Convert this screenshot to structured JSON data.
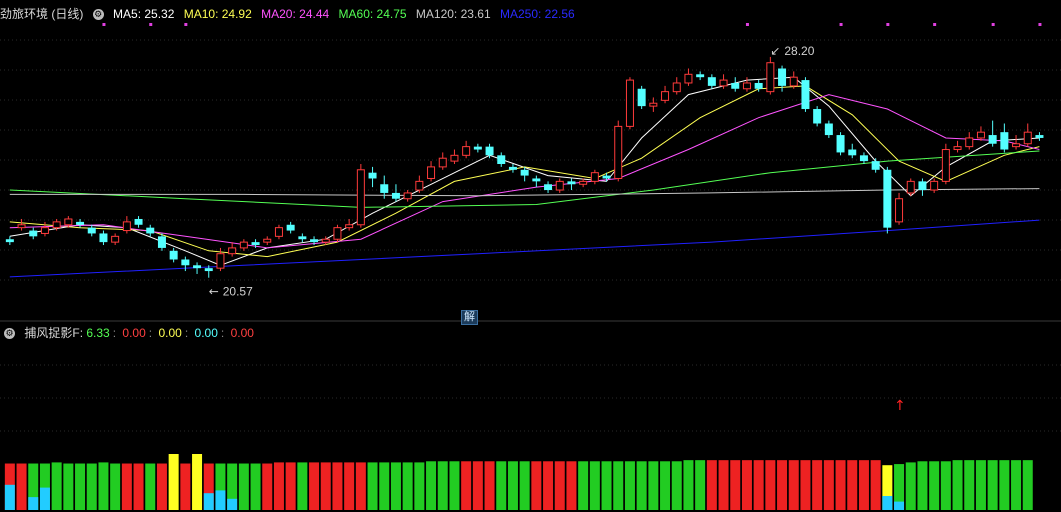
{
  "main_header": {
    "stock_name": "劲旅环境 (日线)",
    "ma5": "MA5: 25.32",
    "ma10": "MA10: 24.92",
    "ma20": "MA20: 24.44",
    "ma60": "MA60: 24.75",
    "ma120": "MA120: 23.61",
    "ma250": "MA250: 22.56"
  },
  "sub_header": {
    "name": "捕风捉影F",
    "v1": "6.33",
    "v2": "0.00",
    "v3": "0.00",
    "v4": "0.00",
    "v5": "0.00"
  },
  "badge_label": "解",
  "colors": {
    "up": "#ff3b3b",
    "down": "#54ffff",
    "ma5": "#ffffff",
    "ma10": "#ffff54",
    "ma20": "#ff54ff",
    "ma60": "#54ff54",
    "ma120": "#c8c8c8",
    "ma250": "#2020ff",
    "green_bar": "#22cc22",
    "red_bar": "#ee2222",
    "yellow_bar": "#ffff22",
    "cyan_bar": "#22ccff"
  },
  "chart_data": {
    "type": "candlestick",
    "price_range": [
      19.8,
      29.2
    ],
    "high_marker": "28.20",
    "low_marker": "20.57",
    "candles": [
      [
        21.9,
        21.8,
        22.0,
        21.7
      ],
      [
        22.3,
        22.4,
        22.6,
        22.2
      ],
      [
        22.2,
        22.0,
        22.3,
        21.9
      ],
      [
        22.1,
        22.3,
        22.5,
        22.0
      ],
      [
        22.3,
        22.5,
        22.6,
        22.2
      ],
      [
        22.4,
        22.6,
        22.7,
        22.3
      ],
      [
        22.5,
        22.4,
        22.6,
        22.3
      ],
      [
        22.3,
        22.1,
        22.4,
        22.0
      ],
      [
        22.1,
        21.8,
        22.2,
        21.7
      ],
      [
        21.8,
        22.0,
        22.1,
        21.7
      ],
      [
        22.2,
        22.5,
        22.7,
        22.1
      ],
      [
        22.6,
        22.4,
        22.7,
        22.3
      ],
      [
        22.3,
        22.1,
        22.4,
        22.0
      ],
      [
        22.0,
        21.6,
        22.1,
        21.5
      ],
      [
        21.5,
        21.2,
        21.6,
        21.1
      ],
      [
        21.2,
        21.0,
        21.3,
        20.8
      ],
      [
        21.0,
        20.9,
        21.1,
        20.7
      ],
      [
        20.9,
        20.8,
        21.0,
        20.57
      ],
      [
        20.9,
        21.4,
        21.6,
        20.8
      ],
      [
        21.4,
        21.6,
        21.8,
        21.3
      ],
      [
        21.6,
        21.8,
        21.9,
        21.5
      ],
      [
        21.8,
        21.7,
        21.9,
        21.6
      ],
      [
        21.8,
        21.9,
        22.0,
        21.7
      ],
      [
        22.0,
        22.3,
        22.4,
        21.9
      ],
      [
        22.4,
        22.2,
        22.5,
        22.1
      ],
      [
        22.0,
        21.9,
        22.1,
        21.8
      ],
      [
        21.9,
        21.8,
        22.0,
        21.7
      ],
      [
        21.8,
        21.9,
        22.0,
        21.7
      ],
      [
        21.9,
        22.3,
        22.4,
        21.8
      ],
      [
        22.3,
        22.4,
        22.6,
        22.2
      ],
      [
        22.4,
        24.3,
        24.5,
        22.3
      ],
      [
        24.2,
        24.0,
        24.4,
        23.7
      ],
      [
        23.8,
        23.5,
        24.1,
        23.3
      ],
      [
        23.5,
        23.3,
        23.8,
        23.2
      ],
      [
        23.3,
        23.5,
        23.6,
        23.2
      ],
      [
        23.6,
        23.9,
        24.1,
        23.5
      ],
      [
        24.0,
        24.4,
        24.6,
        23.9
      ],
      [
        24.4,
        24.7,
        24.9,
        24.3
      ],
      [
        24.6,
        24.8,
        25.0,
        24.5
      ],
      [
        24.8,
        25.1,
        25.3,
        24.7
      ],
      [
        25.1,
        25.0,
        25.2,
        24.9
      ],
      [
        25.1,
        24.8,
        25.2,
        24.7
      ],
      [
        24.8,
        24.5,
        24.9,
        24.4
      ],
      [
        24.4,
        24.3,
        24.5,
        24.2
      ],
      [
        24.3,
        24.1,
        24.4,
        23.9
      ],
      [
        24.0,
        23.9,
        24.1,
        23.7
      ],
      [
        23.8,
        23.6,
        23.9,
        23.5
      ],
      [
        23.6,
        23.9,
        24.0,
        23.5
      ],
      [
        23.9,
        23.8,
        24.0,
        23.6
      ],
      [
        23.8,
        23.9,
        24.0,
        23.7
      ],
      [
        23.9,
        24.2,
        24.3,
        23.8
      ],
      [
        24.1,
        24.0,
        24.2,
        23.9
      ],
      [
        24.0,
        25.8,
        26.0,
        23.9
      ],
      [
        25.8,
        27.4,
        27.5,
        25.7
      ],
      [
        27.1,
        26.5,
        27.2,
        26.4
      ],
      [
        26.5,
        26.6,
        26.8,
        26.3
      ],
      [
        26.7,
        27.0,
        27.2,
        26.6
      ],
      [
        27.0,
        27.3,
        27.5,
        26.9
      ],
      [
        27.3,
        27.6,
        27.8,
        27.2
      ],
      [
        27.6,
        27.5,
        27.7,
        27.4
      ],
      [
        27.5,
        27.2,
        27.6,
        27.1
      ],
      [
        27.2,
        27.4,
        27.6,
        27.1
      ],
      [
        27.3,
        27.1,
        27.5,
        27.0
      ],
      [
        27.1,
        27.3,
        27.5,
        27.0
      ],
      [
        27.3,
        27.1,
        27.4,
        27.0
      ],
      [
        27.0,
        28.0,
        28.2,
        26.9
      ],
      [
        27.8,
        27.2,
        27.9,
        27.0
      ],
      [
        27.2,
        27.5,
        27.7,
        27.1
      ],
      [
        27.4,
        26.4,
        27.5,
        26.3
      ],
      [
        26.4,
        25.9,
        26.5,
        25.8
      ],
      [
        25.9,
        25.5,
        26.0,
        25.4
      ],
      [
        25.5,
        24.9,
        25.6,
        24.8
      ],
      [
        25.0,
        24.8,
        25.2,
        24.7
      ],
      [
        24.8,
        24.6,
        24.9,
        24.5
      ],
      [
        24.6,
        24.3,
        24.7,
        24.2
      ],
      [
        24.3,
        22.3,
        24.4,
        22.1
      ],
      [
        22.5,
        23.3,
        23.5,
        22.4
      ],
      [
        23.5,
        23.9,
        24.0,
        23.4
      ],
      [
        23.9,
        23.6,
        24.0,
        23.4
      ],
      [
        23.6,
        23.9,
        24.0,
        23.5
      ],
      [
        23.9,
        25.0,
        25.2,
        23.8
      ],
      [
        25.0,
        25.1,
        25.3,
        24.9
      ],
      [
        25.1,
        25.4,
        25.6,
        25.0
      ],
      [
        25.4,
        25.6,
        25.8,
        25.3
      ],
      [
        25.5,
        25.2,
        26.0,
        25.1
      ],
      [
        25.6,
        25.0,
        25.9,
        24.9
      ],
      [
        25.1,
        25.2,
        25.5,
        25.0
      ],
      [
        25.2,
        25.6,
        25.9,
        25.1
      ],
      [
        25.5,
        25.4,
        25.6,
        25.3
      ]
    ],
    "ma": {
      "ma5": [
        [
          0,
          22.0
        ],
        [
          6,
          22.4
        ],
        [
          10,
          22.3
        ],
        [
          15,
          21.5
        ],
        [
          18,
          21.0
        ],
        [
          22,
          21.6
        ],
        [
          27,
          21.9
        ],
        [
          31,
          22.8
        ],
        [
          36,
          23.8
        ],
        [
          41,
          24.8
        ],
        [
          46,
          24.1
        ],
        [
          51,
          23.9
        ],
        [
          54,
          25.4
        ],
        [
          58,
          26.9
        ],
        [
          63,
          27.4
        ],
        [
          67,
          27.5
        ],
        [
          70,
          26.5
        ],
        [
          74,
          24.6
        ],
        [
          77,
          23.4
        ],
        [
          80,
          24.4
        ],
        [
          84,
          25.3
        ],
        [
          88,
          25.4
        ]
      ],
      "ma10": [
        [
          0,
          22.5
        ],
        [
          6,
          22.3
        ],
        [
          12,
          22.2
        ],
        [
          17,
          21.5
        ],
        [
          22,
          21.3
        ],
        [
          28,
          21.8
        ],
        [
          33,
          22.8
        ],
        [
          38,
          23.9
        ],
        [
          44,
          24.4
        ],
        [
          50,
          24.0
        ],
        [
          54,
          24.7
        ],
        [
          59,
          26.1
        ],
        [
          64,
          27.1
        ],
        [
          68,
          27.2
        ],
        [
          72,
          26.2
        ],
        [
          76,
          24.6
        ],
        [
          80,
          23.9
        ],
        [
          85,
          24.8
        ],
        [
          88,
          25.1
        ]
      ],
      "ma20": [
        [
          0,
          22.3
        ],
        [
          8,
          22.4
        ],
        [
          15,
          22.0
        ],
        [
          22,
          21.6
        ],
        [
          30,
          21.9
        ],
        [
          37,
          23.2
        ],
        [
          45,
          23.7
        ],
        [
          52,
          24.0
        ],
        [
          58,
          25.0
        ],
        [
          64,
          26.1
        ],
        [
          70,
          26.9
        ],
        [
          75,
          26.4
        ],
        [
          80,
          25.4
        ],
        [
          85,
          25.3
        ],
        [
          88,
          25.0
        ]
      ],
      "ma60": [
        [
          0,
          23.6
        ],
        [
          15,
          23.3
        ],
        [
          30,
          23.0
        ],
        [
          45,
          23.1
        ],
        [
          55,
          23.6
        ],
        [
          65,
          24.2
        ],
        [
          75,
          24.6
        ],
        [
          88,
          24.95
        ]
      ],
      "ma120": [
        [
          0,
          23.45
        ],
        [
          20,
          23.45
        ],
        [
          40,
          23.4
        ],
        [
          60,
          23.5
        ],
        [
          75,
          23.6
        ],
        [
          88,
          23.65
        ]
      ],
      "ma250": [
        [
          0,
          20.6
        ],
        [
          20,
          21.0
        ],
        [
          40,
          21.4
        ],
        [
          60,
          21.8
        ],
        [
          75,
          22.2
        ],
        [
          88,
          22.56
        ]
      ]
    },
    "top_marks": [
      8,
      12,
      15,
      63,
      71,
      75,
      79,
      84,
      88
    ],
    "indicator_bars": [
      [
        "red",
        "cyan"
      ],
      [
        "red",
        "none"
      ],
      [
        "green",
        "cyan"
      ],
      [
        "green",
        "cyan"
      ],
      [
        "green",
        "none"
      ],
      [
        "green",
        "none"
      ],
      [
        "green",
        "none"
      ],
      [
        "green",
        "none"
      ],
      [
        "green",
        "none"
      ],
      [
        "green",
        "none"
      ],
      [
        "red",
        "none"
      ],
      [
        "red",
        "none"
      ],
      [
        "green",
        "none"
      ],
      [
        "red",
        "none"
      ],
      [
        "yellow",
        "none"
      ],
      [
        "red",
        "none"
      ],
      [
        "yellow",
        "none"
      ],
      [
        "red",
        "cyan"
      ],
      [
        "green",
        "cyan"
      ],
      [
        "green",
        "cyan"
      ],
      [
        "green",
        "none"
      ],
      [
        "green",
        "none"
      ],
      [
        "red",
        "none"
      ],
      [
        "red",
        "none"
      ],
      [
        "red",
        "none"
      ],
      [
        "green",
        "none"
      ],
      [
        "red",
        "none"
      ],
      [
        "red",
        "none"
      ],
      [
        "red",
        "none"
      ],
      [
        "red",
        "none"
      ],
      [
        "red",
        "none"
      ],
      [
        "green",
        "none"
      ],
      [
        "green",
        "none"
      ],
      [
        "green",
        "none"
      ],
      [
        "green",
        "none"
      ],
      [
        "green",
        "none"
      ],
      [
        "green",
        "none"
      ],
      [
        "green",
        "none"
      ],
      [
        "green",
        "none"
      ],
      [
        "red",
        "none"
      ],
      [
        "red",
        "none"
      ],
      [
        "red",
        "none"
      ],
      [
        "green",
        "none"
      ],
      [
        "green",
        "none"
      ],
      [
        "green",
        "none"
      ],
      [
        "red",
        "none"
      ],
      [
        "red",
        "none"
      ],
      [
        "red",
        "none"
      ],
      [
        "red",
        "none"
      ],
      [
        "green",
        "none"
      ],
      [
        "green",
        "none"
      ],
      [
        "green",
        "none"
      ],
      [
        "green",
        "none"
      ],
      [
        "green",
        "none"
      ],
      [
        "green",
        "none"
      ],
      [
        "green",
        "none"
      ],
      [
        "green",
        "none"
      ],
      [
        "green",
        "none"
      ],
      [
        "green",
        "none"
      ],
      [
        "green",
        "none"
      ],
      [
        "red",
        "none"
      ],
      [
        "red",
        "none"
      ],
      [
        "red",
        "none"
      ],
      [
        "red",
        "none"
      ],
      [
        "red",
        "none"
      ],
      [
        "red",
        "none"
      ],
      [
        "red",
        "none"
      ],
      [
        "red",
        "none"
      ],
      [
        "red",
        "none"
      ],
      [
        "red",
        "none"
      ],
      [
        "red",
        "none"
      ],
      [
        "red",
        "none"
      ],
      [
        "red",
        "none"
      ],
      [
        "red",
        "none"
      ],
      [
        "red",
        "none"
      ],
      [
        "yellow",
        "cyan"
      ],
      [
        "green",
        "cyan"
      ],
      [
        "green",
        "none"
      ],
      [
        "green",
        "none"
      ],
      [
        "green",
        "none"
      ],
      [
        "green",
        "none"
      ],
      [
        "green",
        "none"
      ],
      [
        "green",
        "none"
      ],
      [
        "green",
        "none"
      ],
      [
        "green",
        "none"
      ],
      [
        "green",
        "none"
      ],
      [
        "green",
        "none"
      ],
      [
        "green",
        "none"
      ]
    ],
    "indicator_heights": [
      46,
      46,
      46,
      46,
      46,
      46,
      46,
      46,
      46,
      46,
      46,
      46,
      46,
      46,
      46,
      46,
      46,
      46,
      46,
      46,
      46,
      46,
      46,
      46,
      46,
      46,
      46,
      46,
      46,
      46,
      46,
      46,
      46,
      46,
      46,
      46,
      46,
      46,
      46,
      46,
      46,
      46,
      46,
      46,
      46,
      46,
      46,
      46,
      46,
      46,
      46,
      46,
      46,
      46,
      46,
      46,
      46,
      46,
      46,
      46,
      46,
      46,
      46,
      46,
      46,
      46,
      46,
      46,
      46,
      46,
      46,
      46,
      46,
      46,
      46,
      46,
      46,
      46,
      46,
      46,
      46,
      46,
      46,
      46,
      46,
      46,
      46,
      46
    ],
    "indicator_scale_max": 1.0,
    "indicator_values": [
      0.83,
      0.83,
      0.83,
      0.83,
      0.85,
      0.83,
      0.83,
      0.83,
      0.85,
      0.83,
      0.83,
      0.83,
      0.83,
      0.83,
      1.0,
      0.83,
      1.0,
      0.83,
      0.83,
      0.83,
      0.83,
      0.83,
      0.83,
      0.85,
      0.85,
      0.85,
      0.85,
      0.85,
      0.85,
      0.85,
      0.85,
      0.85,
      0.85,
      0.85,
      0.85,
      0.85,
      0.87,
      0.87,
      0.87,
      0.87,
      0.87,
      0.87,
      0.87,
      0.87,
      0.87,
      0.87,
      0.87,
      0.87,
      0.87,
      0.87,
      0.87,
      0.87,
      0.87,
      0.87,
      0.87,
      0.87,
      0.87,
      0.87,
      0.89,
      0.89,
      0.89,
      0.89,
      0.89,
      0.89,
      0.89,
      0.89,
      0.89,
      0.89,
      0.89,
      0.89,
      0.89,
      0.89,
      0.89,
      0.89,
      0.89,
      0.8,
      0.82,
      0.85,
      0.87,
      0.87,
      0.87,
      0.89,
      0.89,
      0.89,
      0.89,
      0.89,
      0.89,
      0.89
    ],
    "cyan_values": [
      0.45,
      0,
      0.23,
      0.4,
      0,
      0,
      0,
      0,
      0,
      0,
      0,
      0,
      0,
      0,
      0,
      0,
      0,
      0.3,
      0.35,
      0.2,
      0,
      0,
      0,
      0,
      0,
      0,
      0,
      0,
      0,
      0,
      0,
      0,
      0,
      0,
      0,
      0,
      0,
      0,
      0,
      0,
      0,
      0,
      0,
      0,
      0,
      0,
      0,
      0,
      0,
      0,
      0,
      0,
      0,
      0,
      0,
      0,
      0,
      0,
      0,
      0,
      0,
      0,
      0,
      0,
      0,
      0,
      0,
      0,
      0,
      0,
      0,
      0,
      0,
      0,
      0,
      0.25,
      0.15,
      0,
      0,
      0,
      0,
      0,
      0,
      0,
      0,
      0,
      0,
      0
    ],
    "buy_arrow_index": 76
  }
}
